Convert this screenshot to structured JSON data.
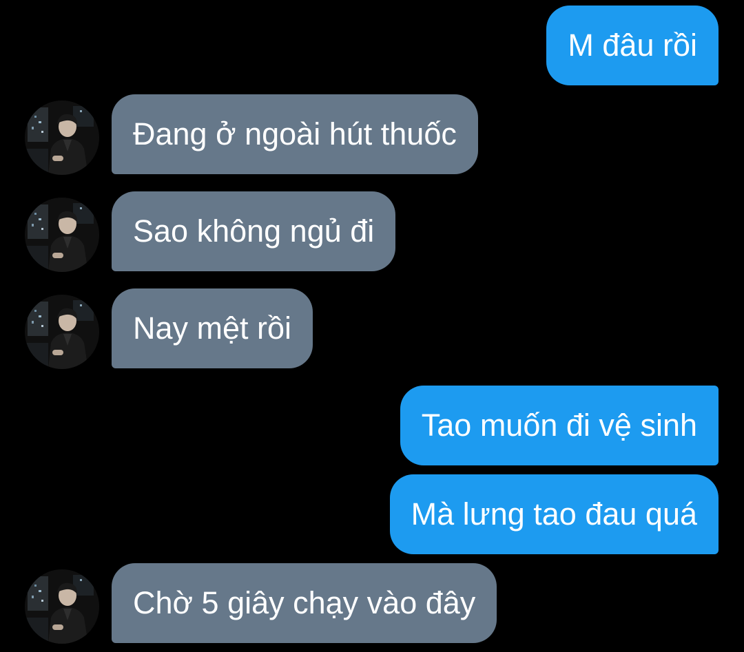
{
  "conversation": {
    "colors": {
      "background": "#000000",
      "outgoing_bubble": "#1d9bf0",
      "incoming_bubble": "#66788a",
      "text": "#ffffff"
    },
    "messages": [
      {
        "direction": "outgoing",
        "text": "M đâu rồi"
      },
      {
        "direction": "incoming",
        "text": "Đang ở ngoài hút thuốc",
        "avatar": "contact-avatar-photo"
      },
      {
        "direction": "incoming",
        "text": "Sao không ngủ đi",
        "avatar": "contact-avatar-photo"
      },
      {
        "direction": "incoming",
        "text": "Nay mệt rồi",
        "avatar": "contact-avatar-photo"
      },
      {
        "direction": "outgoing",
        "text": "Tao muốn đi vệ sinh"
      },
      {
        "direction": "outgoing",
        "text": "Mà lưng tao đau quá"
      },
      {
        "direction": "incoming",
        "text": "Chờ 5 giây chạy vào đây",
        "avatar": "contact-avatar-photo"
      }
    ]
  }
}
